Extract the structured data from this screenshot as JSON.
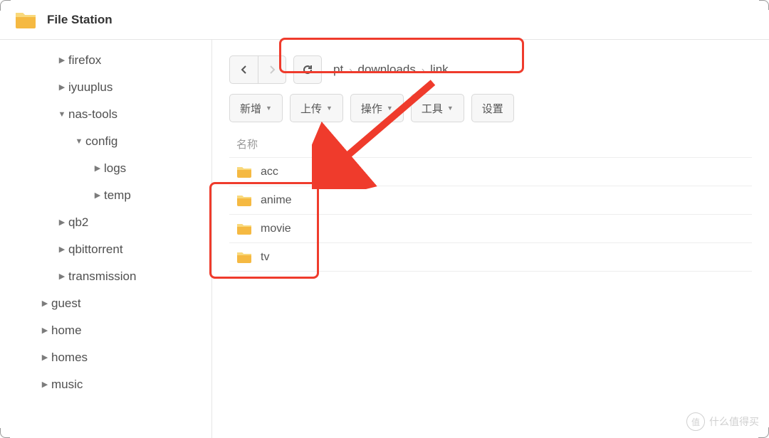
{
  "app": {
    "title": "File Station"
  },
  "sidebar": {
    "items": [
      {
        "label": "firefox",
        "level": 2,
        "expanded": false
      },
      {
        "label": "iyuuplus",
        "level": 2,
        "expanded": false
      },
      {
        "label": "nas-tools",
        "level": 2,
        "expanded": true
      },
      {
        "label": "config",
        "level": 3,
        "expanded": true
      },
      {
        "label": "logs",
        "level": 4,
        "expanded": false
      },
      {
        "label": "temp",
        "level": 4,
        "expanded": false
      },
      {
        "label": "qb2",
        "level": 2,
        "expanded": false
      },
      {
        "label": "qbittorrent",
        "level": 2,
        "expanded": false
      },
      {
        "label": "transmission",
        "level": 2,
        "expanded": false
      },
      {
        "label": "guest",
        "level": 1,
        "expanded": false
      },
      {
        "label": "home",
        "level": 1,
        "expanded": false
      },
      {
        "label": "homes",
        "level": 1,
        "expanded": false
      },
      {
        "label": "music",
        "level": 1,
        "expanded": false
      }
    ]
  },
  "breadcrumb": {
    "parts": [
      "pt",
      "downloads",
      "link"
    ]
  },
  "toolbar": {
    "new": "新增",
    "upload": "上传",
    "action": "操作",
    "tools": "工具",
    "settings": "设置"
  },
  "grid": {
    "header_name": "名称",
    "rows": [
      {
        "name": "acc"
      },
      {
        "name": "anime"
      },
      {
        "name": "movie"
      },
      {
        "name": "tv"
      }
    ]
  },
  "watermark": {
    "text": "什么值得买"
  }
}
